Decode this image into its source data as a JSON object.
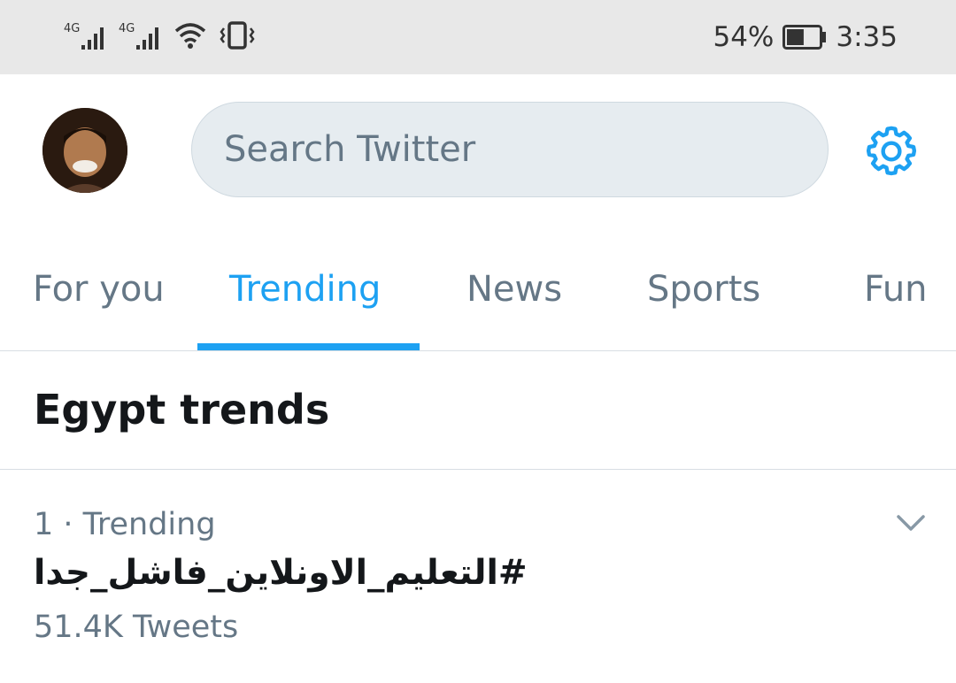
{
  "status_bar": {
    "network_1": "4G",
    "network_2": "4G",
    "battery_percent": "54%",
    "battery_level": 0.54,
    "time": "3:35"
  },
  "header": {
    "search_placeholder": "Search Twitter"
  },
  "tabs": [
    {
      "label": "For you",
      "active": false
    },
    {
      "label": "Trending",
      "active": true
    },
    {
      "label": "News",
      "active": false
    },
    {
      "label": "Sports",
      "active": false
    },
    {
      "label": "Fun",
      "active": false
    }
  ],
  "section": {
    "title": "Egypt trends"
  },
  "trends": [
    {
      "meta": "1 · Trending",
      "name": "#التعليم_الاونلاين_فاشل_جدا",
      "count": "51.4K Tweets"
    }
  ],
  "colors": {
    "accent": "#1da1f2",
    "secondary_text": "#657786",
    "search_bg": "#e6ecf0"
  }
}
